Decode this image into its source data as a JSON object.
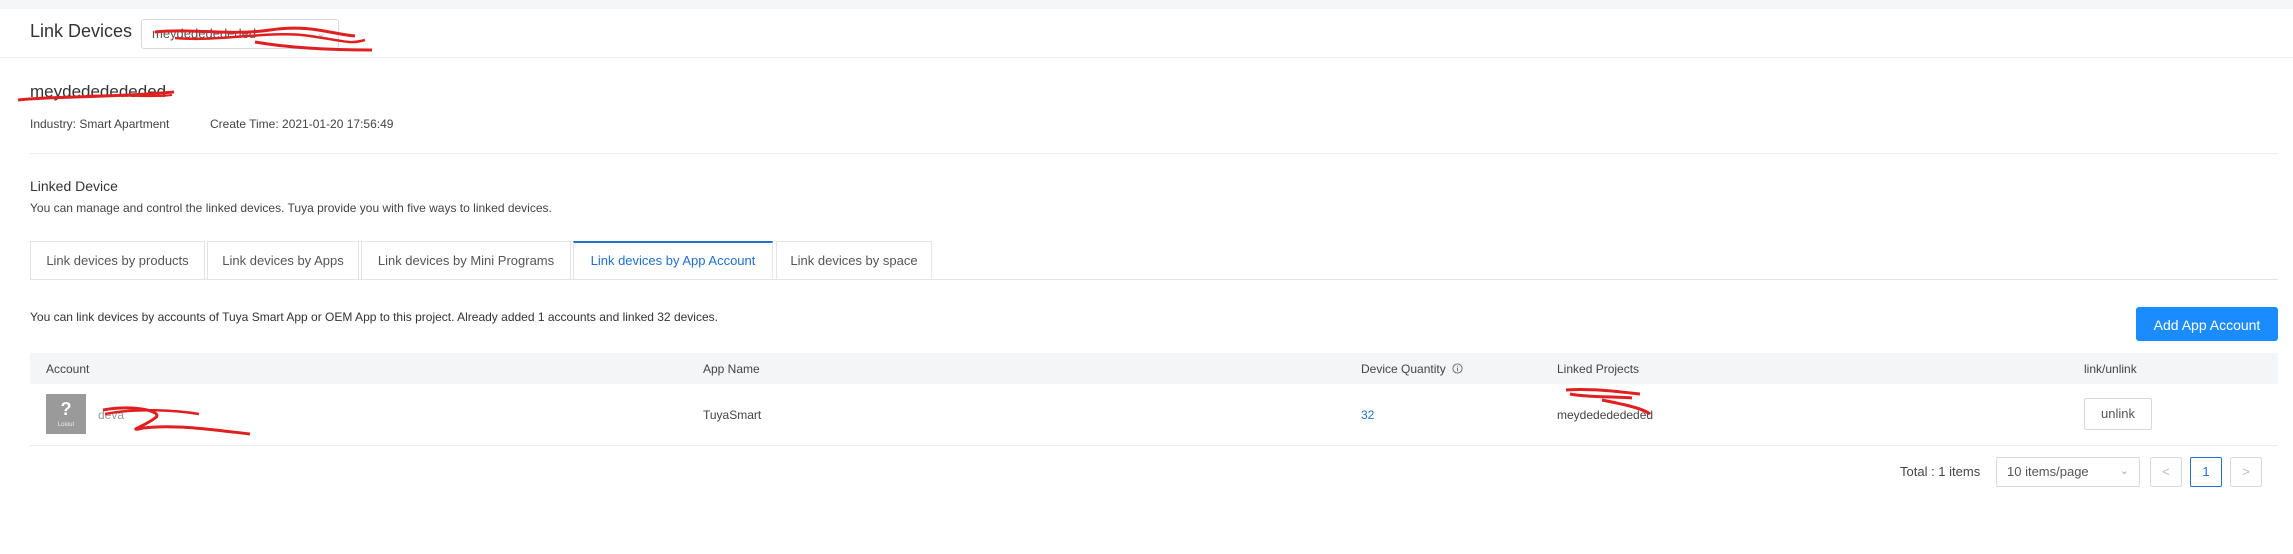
{
  "header": {
    "title": "Link Devices",
    "project_select_value": "meydededededed",
    "chevron_icon": "chevron-down-icon"
  },
  "project": {
    "name": "meydededededed",
    "industry": "Industry: Smart Apartment",
    "create_time": "Create Time: 2021-01-20 17:56:49"
  },
  "linked_device": {
    "title": "Linked Device",
    "description": "You can manage and control the linked devices. Tuya provide you with five ways to linked devices."
  },
  "tabs": [
    {
      "label": "Link devices by products",
      "active": false
    },
    {
      "label": "Link devices by Apps",
      "active": false
    },
    {
      "label": "Link devices by Mini Programs",
      "active": false
    },
    {
      "label": "Link devices by App Account",
      "active": true
    },
    {
      "label": "Link devices by space",
      "active": false
    }
  ],
  "account_section": {
    "info": "You can link devices by accounts of Tuya Smart App or OEM App to this project. Already added 1 accounts and linked 32 devices.",
    "add_button": "Add App Account"
  },
  "table": {
    "columns": [
      "Account",
      "App Name",
      "Device Quantity",
      "Linked Projects",
      "link/unlink"
    ],
    "rows": [
      {
        "account": "deva",
        "avatar_symbol": "?",
        "avatar_label": "Loiout",
        "app_name": "TuyaSmart",
        "device_quantity": "32",
        "linked_projects": "meydededededed",
        "action": "unlink"
      }
    ]
  },
  "pagination": {
    "total": "Total : 1 items",
    "page_size": "10 items/page",
    "prev": "<",
    "current_page": "1",
    "next": ">"
  },
  "colors": {
    "accent": "#1f6fd1",
    "primary_button": "#1a8cff",
    "redaction": "#e02020"
  }
}
